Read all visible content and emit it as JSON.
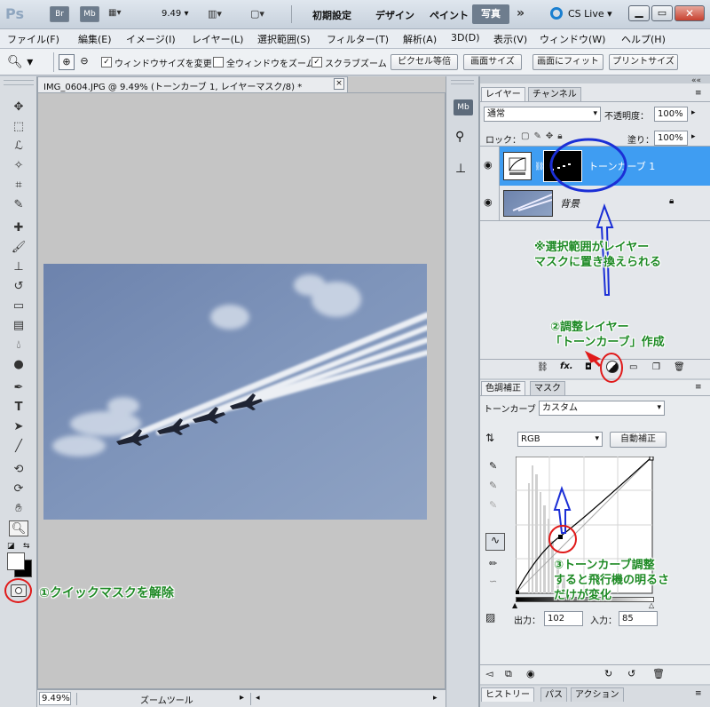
{
  "titlebar": {
    "app_logo": "Ps",
    "bridge_btn": "Br",
    "minibridge_btn": "Mb",
    "zoom_value": "9.49",
    "workspaces": [
      "初期設定",
      "デザイン",
      "ペイント",
      "写真"
    ],
    "more": "»",
    "cslive": "CS Live",
    "window_controls": [
      "minimize",
      "restore",
      "close"
    ]
  },
  "menubar": {
    "items": [
      "ファイル(F)",
      "編集(E)",
      "イメージ(I)",
      "レイヤー(L)",
      "選択範囲(S)",
      "フィルター(T)",
      "解析(A)",
      "3D(D)",
      "表示(V)",
      "ウィンドウ(W)",
      "ヘルプ(H)"
    ]
  },
  "optionsbar": {
    "checkbox1": "ウィンドウサイズを変更",
    "checkbox2": "全ウィンドウをズーム",
    "checkbox3": "スクラブズーム",
    "checkbox1_checked": true,
    "checkbox2_checked": false,
    "checkbox3_checked": true,
    "buttons": [
      "ピクセル等倍",
      "画面サイズ",
      "画面にフィット",
      "プリントサイズ"
    ]
  },
  "document": {
    "tab_title": "IMG_0604.JPG @ 9.49% (トーンカーブ 1, レイヤーマスク/8) *",
    "close": "×",
    "status_zoom": "9.49%",
    "status_text": "ズームツール"
  },
  "layers_panel": {
    "tabs": [
      "レイヤー",
      "チャンネル"
    ],
    "blend_mode": "通常",
    "opacity_label": "不透明度：",
    "opacity_value": "100%",
    "lock_label": "ロック：",
    "fill_label": "塗り：",
    "fill_value": "100%",
    "layers": [
      {
        "name": "トーンカーブ 1",
        "selected": true
      },
      {
        "name": "背景",
        "selected": false
      }
    ],
    "footer_fx": "fx."
  },
  "adjustments_panel": {
    "tabs": [
      "色調補正",
      "マスク"
    ],
    "type_label": "トーンカーブ",
    "preset_value": "カスタム",
    "channel_value": "RGB",
    "auto_button": "自動補正",
    "output_label": "出力：",
    "output_value": "102",
    "input_label": "入力：",
    "input_value": "85"
  },
  "history_panel": {
    "tabs": [
      "ヒストリー",
      "パス",
      "アクション"
    ]
  },
  "annotations": {
    "note1": "※選択範囲がレイヤー\nマスクに置き換えられる",
    "note2": "②調整レイヤー\n「トーンカーブ」作成",
    "note3": "③トーンカーブ調整\nすると飛行機の明るさ\nだけが変化",
    "note4": "①クイックマスクを解除"
  },
  "colors": {
    "selected_layer": "#3f9df2",
    "annotation_green": "#1e8a25",
    "annotation_red": "#e01a1a",
    "annotation_blue": "#1b2fd6",
    "sky": "#7e93b8"
  }
}
